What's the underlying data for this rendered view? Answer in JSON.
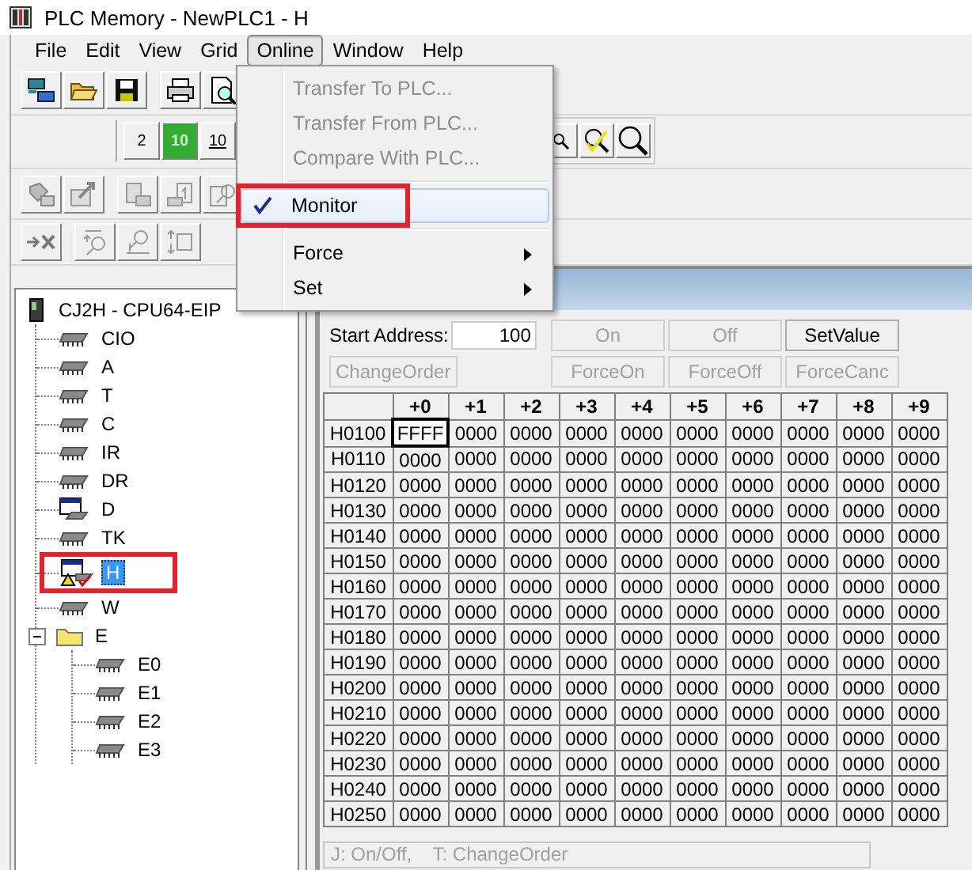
{
  "window": {
    "title": "PLC Memory - NewPLC1 - H"
  },
  "menu_bar": [
    {
      "label": "File",
      "selected": false
    },
    {
      "label": "Edit",
      "selected": false
    },
    {
      "label": "View",
      "selected": false
    },
    {
      "label": "Grid",
      "selected": false
    },
    {
      "label": "Online",
      "selected": true
    },
    {
      "label": "Window",
      "selected": false
    },
    {
      "label": "Help",
      "selected": false
    }
  ],
  "online_menu": [
    {
      "kind": "command",
      "label": "Transfer To PLC...",
      "disabled": true,
      "selected": false
    },
    {
      "kind": "command",
      "label": "Transfer From PLC...",
      "disabled": true,
      "selected": false
    },
    {
      "kind": "command",
      "label": "Compare With PLC...",
      "disabled": true,
      "selected": false
    },
    {
      "kind": "separator"
    },
    {
      "kind": "check",
      "label": "Monitor",
      "checked": true,
      "disabled": false,
      "selected": true,
      "highlighted": true
    },
    {
      "kind": "separator"
    },
    {
      "kind": "submenu",
      "label": "Force",
      "disabled": false,
      "selected": false
    },
    {
      "kind": "submenu",
      "label": "Set",
      "disabled": false,
      "selected": false
    }
  ],
  "display_buttons": [
    {
      "label": "2",
      "kind": "plain"
    },
    {
      "label": "10",
      "kind": "lit"
    },
    {
      "label": "10",
      "kind": "underlined"
    }
  ],
  "memory_tree": {
    "label": "CJ2H - CPU64-EIP",
    "children": [
      {
        "label": "CIO",
        "kind": "chip",
        "selected": false
      },
      {
        "label": "A",
        "kind": "chip",
        "selected": false
      },
      {
        "label": "T",
        "kind": "chip",
        "selected": false
      },
      {
        "label": "C",
        "kind": "chip",
        "selected": false
      },
      {
        "label": "IR",
        "kind": "chip",
        "selected": false
      },
      {
        "label": "DR",
        "kind": "chip",
        "selected": false
      },
      {
        "label": "D",
        "kind": "monitored",
        "selected": false
      },
      {
        "label": "TK",
        "kind": "chip",
        "selected": false
      },
      {
        "label": "H",
        "kind": "monitored-alert",
        "selected": true,
        "highlighted": true
      },
      {
        "label": "W",
        "kind": "chip",
        "selected": false
      },
      {
        "label": "E",
        "kind": "folder",
        "selected": false,
        "expanded": true,
        "children": [
          {
            "label": "E0",
            "kind": "chip",
            "selected": false
          },
          {
            "label": "E1",
            "kind": "chip",
            "selected": false
          },
          {
            "label": "E2",
            "kind": "chip",
            "selected": false
          },
          {
            "label": "E3",
            "kind": "chip",
            "selected": false
          }
        ]
      }
    ]
  },
  "editor": {
    "start_address": {
      "label": "Start Address:",
      "value": "100"
    },
    "change_order_button": {
      "label": "ChangeOrder",
      "disabled": true
    },
    "action_buttons": [
      {
        "label": "On",
        "disabled": true
      },
      {
        "label": "Off",
        "disabled": true
      },
      {
        "label": "SetValue",
        "disabled": false
      },
      {
        "label": "ForceOn",
        "disabled": true
      },
      {
        "label": "ForceOff",
        "disabled": true
      },
      {
        "label": "ForceCanc",
        "disabled": true
      }
    ]
  },
  "table": {
    "columns": [
      "+0",
      "+1",
      "+2",
      "+3",
      "+4",
      "+5",
      "+6",
      "+7",
      "+8",
      "+9"
    ],
    "rows": [
      {
        "address": "H0100",
        "cells": [
          {
            "value": "FFFF",
            "selected": true
          },
          {
            "value": "0000",
            "selected": false
          },
          {
            "value": "0000",
            "selected": false
          },
          {
            "value": "0000",
            "selected": false
          },
          {
            "value": "0000",
            "selected": false
          },
          {
            "value": "0000",
            "selected": false
          },
          {
            "value": "0000",
            "selected": false
          },
          {
            "value": "0000",
            "selected": false
          },
          {
            "value": "0000",
            "selected": false
          },
          {
            "value": "0000",
            "selected": false
          }
        ]
      },
      {
        "address": "H0110",
        "cells": [
          {
            "value": "0000",
            "selected": false
          },
          {
            "value": "0000",
            "selected": false
          },
          {
            "value": "0000",
            "selected": false
          },
          {
            "value": "0000",
            "selected": false
          },
          {
            "value": "0000",
            "selected": false
          },
          {
            "value": "0000",
            "selected": false
          },
          {
            "value": "0000",
            "selected": false
          },
          {
            "value": "0000",
            "selected": false
          },
          {
            "value": "0000",
            "selected": false
          },
          {
            "value": "0000",
            "selected": false
          }
        ]
      },
      {
        "address": "H0120",
        "cells": [
          {
            "value": "0000",
            "selected": false
          },
          {
            "value": "0000",
            "selected": false
          },
          {
            "value": "0000",
            "selected": false
          },
          {
            "value": "0000",
            "selected": false
          },
          {
            "value": "0000",
            "selected": false
          },
          {
            "value": "0000",
            "selected": false
          },
          {
            "value": "0000",
            "selected": false
          },
          {
            "value": "0000",
            "selected": false
          },
          {
            "value": "0000",
            "selected": false
          },
          {
            "value": "0000",
            "selected": false
          }
        ]
      },
      {
        "address": "H0130",
        "cells": [
          {
            "value": "0000",
            "selected": false
          },
          {
            "value": "0000",
            "selected": false
          },
          {
            "value": "0000",
            "selected": false
          },
          {
            "value": "0000",
            "selected": false
          },
          {
            "value": "0000",
            "selected": false
          },
          {
            "value": "0000",
            "selected": false
          },
          {
            "value": "0000",
            "selected": false
          },
          {
            "value": "0000",
            "selected": false
          },
          {
            "value": "0000",
            "selected": false
          },
          {
            "value": "0000",
            "selected": false
          }
        ]
      },
      {
        "address": "H0140",
        "cells": [
          {
            "value": "0000",
            "selected": false
          },
          {
            "value": "0000",
            "selected": false
          },
          {
            "value": "0000",
            "selected": false
          },
          {
            "value": "0000",
            "selected": false
          },
          {
            "value": "0000",
            "selected": false
          },
          {
            "value": "0000",
            "selected": false
          },
          {
            "value": "0000",
            "selected": false
          },
          {
            "value": "0000",
            "selected": false
          },
          {
            "value": "0000",
            "selected": false
          },
          {
            "value": "0000",
            "selected": false
          }
        ]
      },
      {
        "address": "H0150",
        "cells": [
          {
            "value": "0000",
            "selected": false
          },
          {
            "value": "0000",
            "selected": false
          },
          {
            "value": "0000",
            "selected": false
          },
          {
            "value": "0000",
            "selected": false
          },
          {
            "value": "0000",
            "selected": false
          },
          {
            "value": "0000",
            "selected": false
          },
          {
            "value": "0000",
            "selected": false
          },
          {
            "value": "0000",
            "selected": false
          },
          {
            "value": "0000",
            "selected": false
          },
          {
            "value": "0000",
            "selected": false
          }
        ]
      },
      {
        "address": "H0160",
        "cells": [
          {
            "value": "0000",
            "selected": false
          },
          {
            "value": "0000",
            "selected": false
          },
          {
            "value": "0000",
            "selected": false
          },
          {
            "value": "0000",
            "selected": false
          },
          {
            "value": "0000",
            "selected": false
          },
          {
            "value": "0000",
            "selected": false
          },
          {
            "value": "0000",
            "selected": false
          },
          {
            "value": "0000",
            "selected": false
          },
          {
            "value": "0000",
            "selected": false
          },
          {
            "value": "0000",
            "selected": false
          }
        ]
      },
      {
        "address": "H0170",
        "cells": [
          {
            "value": "0000",
            "selected": false
          },
          {
            "value": "0000",
            "selected": false
          },
          {
            "value": "0000",
            "selected": false
          },
          {
            "value": "0000",
            "selected": false
          },
          {
            "value": "0000",
            "selected": false
          },
          {
            "value": "0000",
            "selected": false
          },
          {
            "value": "0000",
            "selected": false
          },
          {
            "value": "0000",
            "selected": false
          },
          {
            "value": "0000",
            "selected": false
          },
          {
            "value": "0000",
            "selected": false
          }
        ]
      },
      {
        "address": "H0180",
        "cells": [
          {
            "value": "0000",
            "selected": false
          },
          {
            "value": "0000",
            "selected": false
          },
          {
            "value": "0000",
            "selected": false
          },
          {
            "value": "0000",
            "selected": false
          },
          {
            "value": "0000",
            "selected": false
          },
          {
            "value": "0000",
            "selected": false
          },
          {
            "value": "0000",
            "selected": false
          },
          {
            "value": "0000",
            "selected": false
          },
          {
            "value": "0000",
            "selected": false
          },
          {
            "value": "0000",
            "selected": false
          }
        ]
      },
      {
        "address": "H0190",
        "cells": [
          {
            "value": "0000",
            "selected": false
          },
          {
            "value": "0000",
            "selected": false
          },
          {
            "value": "0000",
            "selected": false
          },
          {
            "value": "0000",
            "selected": false
          },
          {
            "value": "0000",
            "selected": false
          },
          {
            "value": "0000",
            "selected": false
          },
          {
            "value": "0000",
            "selected": false
          },
          {
            "value": "0000",
            "selected": false
          },
          {
            "value": "0000",
            "selected": false
          },
          {
            "value": "0000",
            "selected": false
          }
        ]
      },
      {
        "address": "H0200",
        "cells": [
          {
            "value": "0000",
            "selected": false
          },
          {
            "value": "0000",
            "selected": false
          },
          {
            "value": "0000",
            "selected": false
          },
          {
            "value": "0000",
            "selected": false
          },
          {
            "value": "0000",
            "selected": false
          },
          {
            "value": "0000",
            "selected": false
          },
          {
            "value": "0000",
            "selected": false
          },
          {
            "value": "0000",
            "selected": false
          },
          {
            "value": "0000",
            "selected": false
          },
          {
            "value": "0000",
            "selected": false
          }
        ]
      },
      {
        "address": "H0210",
        "cells": [
          {
            "value": "0000",
            "selected": false
          },
          {
            "value": "0000",
            "selected": false
          },
          {
            "value": "0000",
            "selected": false
          },
          {
            "value": "0000",
            "selected": false
          },
          {
            "value": "0000",
            "selected": false
          },
          {
            "value": "0000",
            "selected": false
          },
          {
            "value": "0000",
            "selected": false
          },
          {
            "value": "0000",
            "selected": false
          },
          {
            "value": "0000",
            "selected": false
          },
          {
            "value": "0000",
            "selected": false
          }
        ]
      },
      {
        "address": "H0220",
        "cells": [
          {
            "value": "0000",
            "selected": false
          },
          {
            "value": "0000",
            "selected": false
          },
          {
            "value": "0000",
            "selected": false
          },
          {
            "value": "0000",
            "selected": false
          },
          {
            "value": "0000",
            "selected": false
          },
          {
            "value": "0000",
            "selected": false
          },
          {
            "value": "0000",
            "selected": false
          },
          {
            "value": "0000",
            "selected": false
          },
          {
            "value": "0000",
            "selected": false
          },
          {
            "value": "0000",
            "selected": false
          }
        ]
      },
      {
        "address": "H0230",
        "cells": [
          {
            "value": "0000",
            "selected": false
          },
          {
            "value": "0000",
            "selected": false
          },
          {
            "value": "0000",
            "selected": false
          },
          {
            "value": "0000",
            "selected": false
          },
          {
            "value": "0000",
            "selected": false
          },
          {
            "value": "0000",
            "selected": false
          },
          {
            "value": "0000",
            "selected": false
          },
          {
            "value": "0000",
            "selected": false
          },
          {
            "value": "0000",
            "selected": false
          },
          {
            "value": "0000",
            "selected": false
          }
        ]
      },
      {
        "address": "H0240",
        "cells": [
          {
            "value": "0000",
            "selected": false
          },
          {
            "value": "0000",
            "selected": false
          },
          {
            "value": "0000",
            "selected": false
          },
          {
            "value": "0000",
            "selected": false
          },
          {
            "value": "0000",
            "selected": false
          },
          {
            "value": "0000",
            "selected": false
          },
          {
            "value": "0000",
            "selected": false
          },
          {
            "value": "0000",
            "selected": false
          },
          {
            "value": "0000",
            "selected": false
          },
          {
            "value": "0000",
            "selected": false
          }
        ]
      },
      {
        "address": "H0250",
        "cells": [
          {
            "value": "0000",
            "selected": false
          },
          {
            "value": "0000",
            "selected": false
          },
          {
            "value": "0000",
            "selected": false
          },
          {
            "value": "0000",
            "selected": false
          },
          {
            "value": "0000",
            "selected": false
          },
          {
            "value": "0000",
            "selected": false
          },
          {
            "value": "0000",
            "selected": false
          },
          {
            "value": "0000",
            "selected": false
          },
          {
            "value": "0000",
            "selected": false
          },
          {
            "value": "0000",
            "selected": false
          }
        ]
      }
    ]
  },
  "status_bar": {
    "hint": "J: On/Off,    T: ChangeOrder",
    "disabled": true
  }
}
